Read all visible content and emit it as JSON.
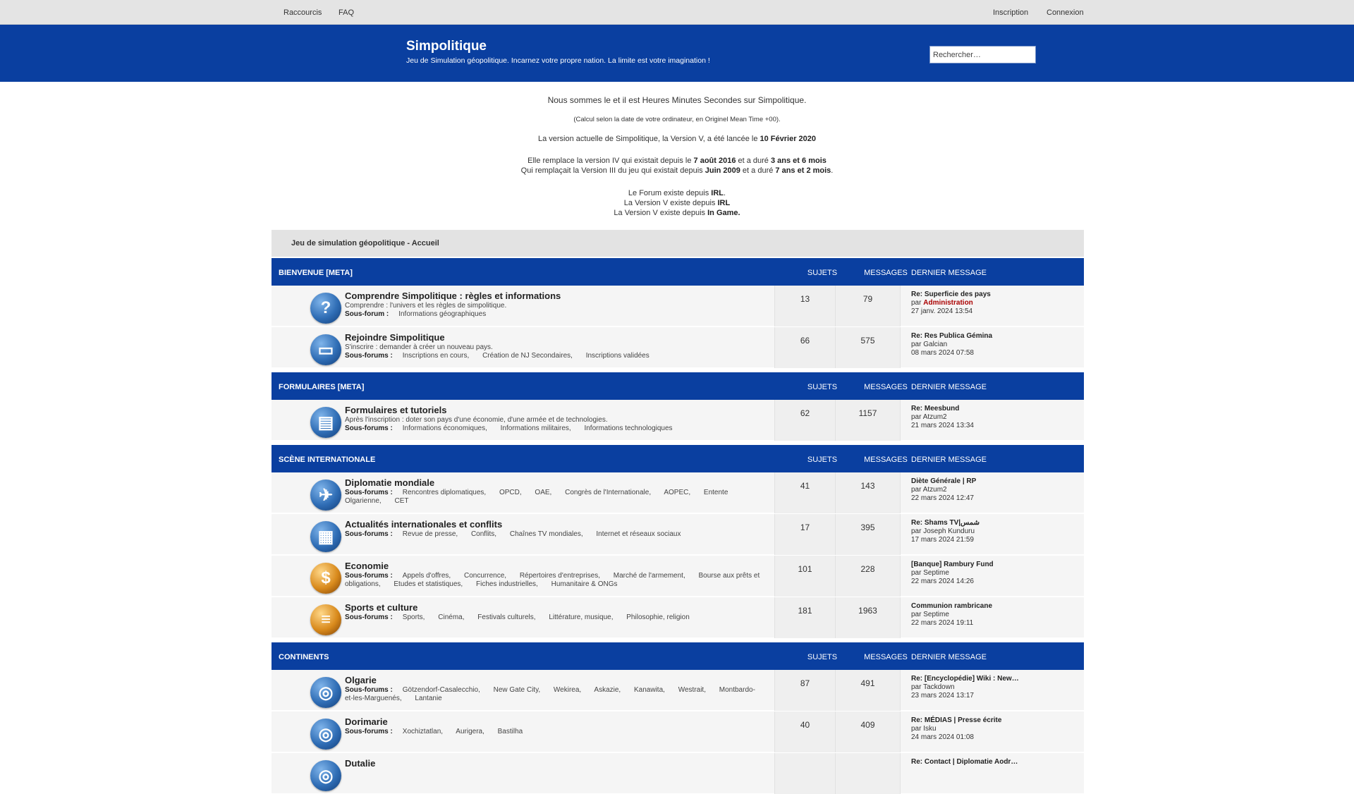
{
  "topbar": {
    "shortcuts": "Raccourcis",
    "faq": "FAQ",
    "register": "Inscription",
    "login": "Connexion"
  },
  "header": {
    "title": "Simpolitique",
    "description": "Jeu de Simulation géopolitique. Incarnez votre propre nation. La limite est votre imagination !",
    "search_placeholder": "Rechercher…"
  },
  "intro": {
    "line1": "Nous sommes le et il est Heures Minutes Secondes sur Simpolitique.",
    "line2": "(Calcul selon la date de votre ordinateur, en Originel Mean Time +00).",
    "line3_a": "La version actuelle de Simpolitique, la Version V, a été lancée le ",
    "line3_b": "10 Février 2020",
    "line4_a": "Elle remplace la version IV qui existait depuis le ",
    "line4_b": "7 août 2016",
    "line4_c": " et a duré ",
    "line4_d": "3 ans et 6 mois",
    "line5_a": "Qui remplaçait la Version III du jeu qui existait depuis ",
    "line5_b": "Juin 2009",
    "line5_c": " et a duré ",
    "line5_d": "7 ans et 2 mois",
    "line5_e": ".",
    "line6_a": "Le Forum existe depuis ",
    "line6_b": "IRL",
    "line6_c": ".",
    "line7_a": "La Version V existe depuis ",
    "line7_b": "IRL",
    "line8_a": "La Version V existe depuis ",
    "line8_b": "In Game."
  },
  "breadcrumb": "Jeu de simulation géopolitique - Accueil",
  "columns": {
    "topics": "SUJETS",
    "posts": "MESSAGES",
    "last": "DERNIER MESSAGE"
  },
  "categories": [
    {
      "name": "BIENVENUE [META]"
    },
    {
      "name": "FORMULAIRES [META]"
    },
    {
      "name": "SCÈNE INTERNATIONALE"
    },
    {
      "name": "CONTINENTS"
    }
  ],
  "forums": [
    {
      "title": "Comprendre Simpolitique : règles et informations",
      "desc": "Comprendre : l'univers et les règles de simpolitique.",
      "sub_label": "Sous-forum :",
      "subs": [
        "Informations géographiques"
      ],
      "topics": "13",
      "posts": "79",
      "last_title": "Re: Superficie des pays",
      "last_by_prefix": "par ",
      "last_by": "Administration",
      "last_date": "27 janv. 2024 13:54",
      "icon": "question-icon"
    },
    {
      "title": "Rejoindre Simpolitique",
      "desc": "S'inscrire : demander à créer un nouveau pays.",
      "sub_label": "Sous-forums :",
      "subs": [
        "Inscriptions en cours,",
        "Création de NJ Secondaires,",
        "Inscriptions validées"
      ],
      "topics": "66",
      "posts": "575",
      "last_title": "Re: Res Publica Gémina",
      "last_by_prefix": "par ",
      "last_by": "Galcian",
      "last_date": "08 mars 2024 07:58",
      "icon": "book-icon"
    },
    {
      "title": "Formulaires et tutoriels",
      "desc": "Après l'inscription : doter son pays d'une économie, d'une armée et de technologies.",
      "sub_label": "Sous-forums :",
      "subs": [
        "Informations économiques,",
        "Informations militaires,",
        "Informations technologiques"
      ],
      "topics": "62",
      "posts": "1157",
      "last_title": "Re: Meesbund",
      "last_by_prefix": "par ",
      "last_by": "Atzum2",
      "last_date": "21 mars 2024 13:34",
      "icon": "document-icon"
    },
    {
      "title": "Diplomatie mondiale",
      "desc": "",
      "sub_label": "Sous-forums :",
      "subs": [
        "Rencontres diplomatiques,",
        "OPCD,",
        "OAE,",
        "Congrès de l'Internationale,",
        "AOPEC,",
        "Entente Olgarienne,",
        "CET"
      ],
      "topics": "41",
      "posts": "143",
      "last_title": "Diète Générale | RP",
      "last_by_prefix": "par ",
      "last_by": "Atzum2",
      "last_date": "22 mars 2024 12:47",
      "icon": "dove-icon"
    },
    {
      "title": "Actualités internationales et conflits",
      "desc": "",
      "sub_label": "Sous-forums :",
      "subs": [
        "Revue de presse,",
        "Conflits,",
        "Chaînes TV mondiales,",
        "Internet et réseaux sociaux"
      ],
      "topics": "17",
      "posts": "395",
      "last_title": "Re: Shams TV|شمس",
      "last_by_prefix": "par ",
      "last_by": "Joseph Kunduru",
      "last_date": "17 mars 2024 21:59",
      "icon": "newspaper-icon"
    },
    {
      "title": "Economie",
      "desc": "",
      "sub_label": "Sous-forums :",
      "subs": [
        "Appels d'offres,",
        "Concurrence,",
        "Répertoires d'entreprises,",
        "Marché de l'armement,",
        "Bourse aux prêts et obligations,",
        "Etudes et statistiques,",
        "Fiches industrielles,",
        "Humanitaire & ONGs"
      ],
      "topics": "101",
      "posts": "228",
      "last_title": "[Banque] Rambury Fund",
      "last_by_prefix": "par ",
      "last_by": "Septime",
      "last_date": "22 mars 2024 14:26",
      "icon": "money-bag-icon"
    },
    {
      "title": "Sports et culture",
      "desc": "",
      "sub_label": "Sous-forums :",
      "subs": [
        "Sports,",
        "Cinéma,",
        "Festivals culturels,",
        "Littérature, musique,",
        "Philosophie, religion"
      ],
      "topics": "181",
      "posts": "1963",
      "last_title": "Communion rambricane",
      "last_by_prefix": "par ",
      "last_by": "Septime",
      "last_date": "22 mars 2024 19:11",
      "icon": "books-icon"
    },
    {
      "title": "Olgarie",
      "desc": "",
      "sub_label": "Sous-forums :",
      "subs": [
        "Götzendorf-Casalecchio,",
        "New Gate City,",
        "Wekirea,",
        "Askazie,",
        "Kanawita,",
        "Westrait,",
        "Montbardo-et-les-Marguenés,",
        "Lantanie"
      ],
      "topics": "87",
      "posts": "491",
      "last_title": "Re: [Encyclopédie] Wiki : New…",
      "last_by_prefix": "par ",
      "last_by": "Tackdown",
      "last_date": "23 mars 2024 13:17",
      "icon": "globe-icon"
    },
    {
      "title": "Dorimarie",
      "desc": "",
      "sub_label": "Sous-forums :",
      "subs": [
        "Xochiztatlan,",
        "Aurigera,",
        "Bastilha"
      ],
      "topics": "40",
      "posts": "409",
      "last_title": "Re: MÉDIAS | Presse écrite",
      "last_by_prefix": "par ",
      "last_by": "Isku",
      "last_date": "24 mars 2024 01:08",
      "icon": "globe-icon"
    },
    {
      "title": "Dutalie",
      "desc": "",
      "sub_label": "",
      "subs": [],
      "topics": "",
      "posts": "",
      "last_title": "Re: Contact | Diplomatie Aodr…",
      "last_by_prefix": "",
      "last_by": "",
      "last_date": "",
      "icon": "globe-icon"
    }
  ]
}
